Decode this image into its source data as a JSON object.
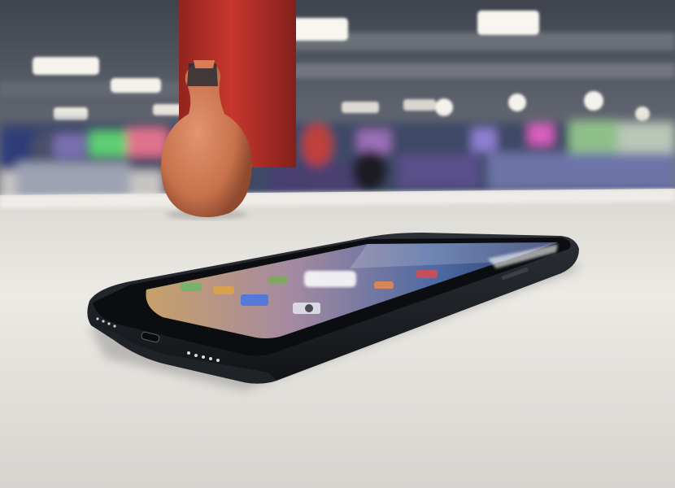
{
  "scene": {
    "subject": "smartphone",
    "setting": "office"
  },
  "colors": {
    "ceiling": "#5c6170",
    "pillar": "#c8352e",
    "table": "#e9e7e2",
    "pot": "#d07a55",
    "phone_body": "#1c1f24"
  },
  "icons": [
    "app-icon"
  ]
}
